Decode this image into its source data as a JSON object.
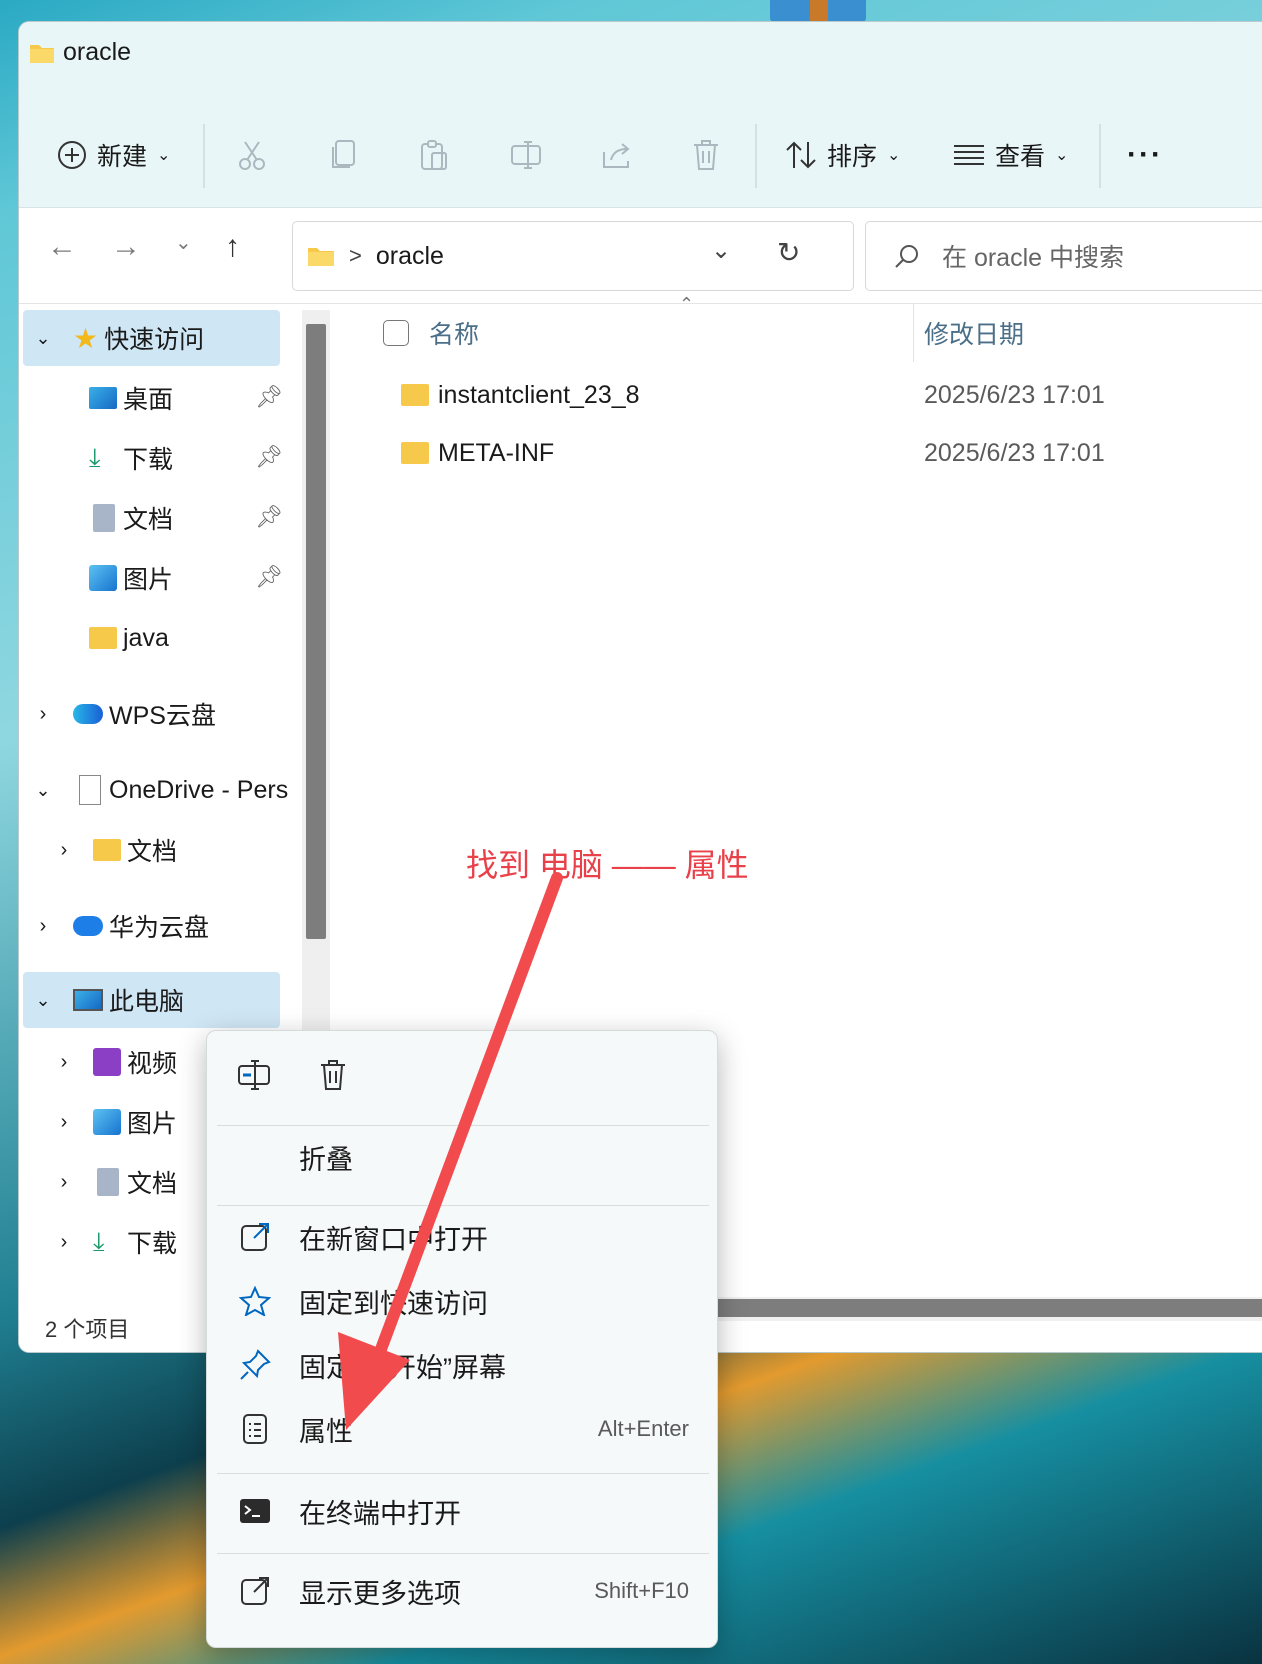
{
  "window": {
    "title": "oracle"
  },
  "toolbar": {
    "new_label": "新建",
    "sort_label": "排序",
    "view_label": "查看",
    "more_label": "···"
  },
  "navbar": {
    "breadcrumb": ">",
    "path": "oracle",
    "search_placeholder": "在 oracle 中搜索"
  },
  "sidebar": {
    "quick_access": "快速访问",
    "quick_items": [
      "桌面",
      "下载",
      "文档",
      "图片",
      "java"
    ],
    "wps": "WPS云盘",
    "onedrive": "OneDrive - Pers",
    "onedrive_docs": "文档",
    "huawei": "华为云盘",
    "this_pc": "此电脑",
    "pc_items": [
      "视频",
      "图片",
      "文档",
      "下载"
    ]
  },
  "content": {
    "columns": {
      "name": "名称",
      "modified": "修改日期"
    },
    "files": [
      {
        "name": "instantclient_23_8",
        "modified": "2025/6/23 17:01"
      },
      {
        "name": "META-INF",
        "modified": "2025/6/23 17:01"
      }
    ]
  },
  "status": {
    "count": "2 个项目"
  },
  "context_menu": {
    "collapse": "折叠",
    "open_new_window": "在新窗口中打开",
    "pin_quick": "固定到快速访问",
    "pin_start": "固定到“开始”屏幕",
    "properties": "属性",
    "properties_shortcut": "Alt+Enter",
    "open_terminal": "在终端中打开",
    "more_options": "显示更多选项",
    "more_shortcut": "Shift+F10"
  },
  "annotation": {
    "text": "找到 电脑 —— 属性",
    "color": "#e8414a"
  },
  "colors": {
    "accent": "#0067c0",
    "folder": "#f6c94b",
    "selection": "#cfe6f5"
  }
}
